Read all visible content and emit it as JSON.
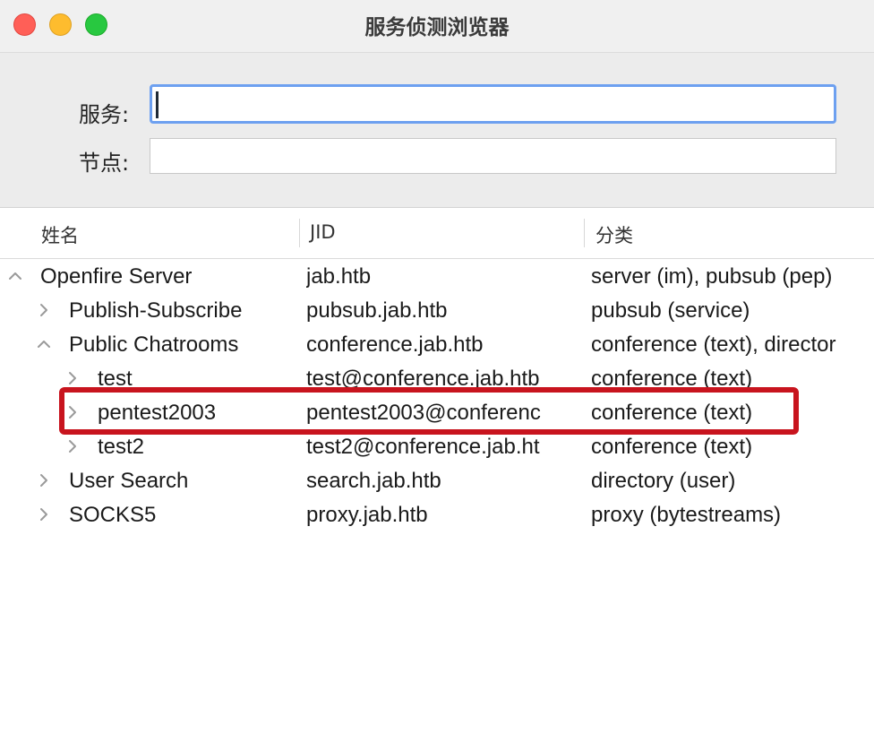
{
  "window": {
    "title": "服务侦测浏览器",
    "accent_color": "#6da0f0",
    "highlight_color": "#c8141e"
  },
  "form": {
    "service_label": "服务:",
    "service_value": "",
    "node_label": "节点:",
    "node_value": ""
  },
  "columns": {
    "name": "姓名",
    "jid": "JID",
    "category": "分类"
  },
  "rows": [
    {
      "name": "Openfire Server",
      "jid": "jab.htb",
      "category": "server (im), pubsub (pep)",
      "expanded": true,
      "level": 0
    },
    {
      "name": "Publish-Subscribe",
      "jid": "pubsub.jab.htb",
      "category": "pubsub (service)",
      "expanded": false,
      "level": 1
    },
    {
      "name": "Public Chatrooms",
      "jid": "conference.jab.htb",
      "category": "conference (text), director",
      "expanded": true,
      "level": 1
    },
    {
      "name": "test",
      "jid": "test@conference.jab.htb",
      "category": "conference (text)",
      "expanded": false,
      "level": 2
    },
    {
      "name": "pentest2003",
      "jid": "pentest2003@conferenc",
      "category": "conference (text)",
      "expanded": false,
      "level": 2,
      "highlighted": true
    },
    {
      "name": "test2",
      "jid": "test2@conference.jab.ht",
      "category": "conference (text)",
      "expanded": false,
      "level": 2
    },
    {
      "name": "User Search",
      "jid": "search.jab.htb",
      "category": "directory (user)",
      "expanded": false,
      "level": 1
    },
    {
      "name": "SOCKS5",
      "jid": "proxy.jab.htb",
      "category": "proxy (bytestreams)",
      "expanded": false,
      "level": 1
    }
  ]
}
